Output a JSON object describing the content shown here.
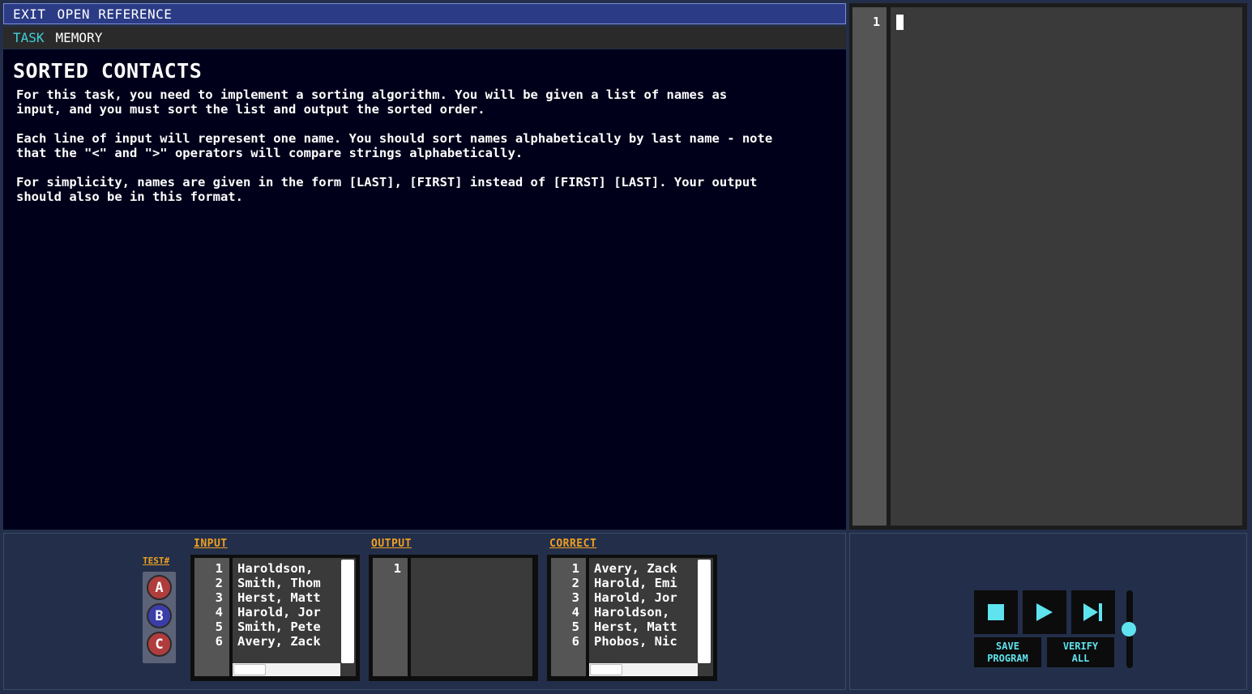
{
  "menu": {
    "exit": "EXIT",
    "open_reference": "OPEN REFERENCE"
  },
  "tabs": [
    {
      "label": "TASK",
      "active": true
    },
    {
      "label": "MEMORY",
      "active": false
    }
  ],
  "task": {
    "title": "SORTED CONTACTS",
    "paragraphs": [
      "For this task, you need to implement a sorting algorithm. You will be given a list of names as\ninput, and you must sort the list and output the sorted order.",
      "Each line of input will represent one name. You should sort names alphabetically by last name - note\nthat the \"<\" and \">\" operators will compare strings alphabetically.",
      "For simplicity, names are given in the form [LAST], [FIRST] instead of [FIRST] [LAST]. Your output\nshould also be in this format."
    ]
  },
  "editor": {
    "line_numbers": [
      "1"
    ]
  },
  "tests": {
    "label": "TEST#",
    "buttons": [
      {
        "label": "A",
        "color": "#b03d3d"
      },
      {
        "label": "B",
        "color": "#3b3ea8",
        "selected": true
      },
      {
        "label": "C",
        "color": "#b03d3d"
      }
    ]
  },
  "io": {
    "input": {
      "label": "INPUT",
      "line_numbers": [
        "1",
        "2",
        "3",
        "4",
        "5",
        "6"
      ],
      "lines": [
        "Haroldson,",
        "Smith, Thom",
        "Herst, Matt",
        "Harold, Jor",
        "Smith, Pete",
        "Avery, Zack"
      ]
    },
    "output": {
      "label": "OUTPUT",
      "line_numbers": [
        "1"
      ],
      "lines": []
    },
    "correct": {
      "label": "CORRECT",
      "line_numbers": [
        "1",
        "2",
        "3",
        "4",
        "5",
        "6"
      ],
      "lines": [
        "Avery, Zack",
        "Harold, Emi",
        "Harold, Jor",
        "Haroldson,",
        "Herst, Matt",
        "Phobos, Nic"
      ]
    }
  },
  "controls": {
    "stop_icon": "stop-icon",
    "run_icon": "play-icon",
    "step_icon": "step-forward-icon",
    "save_label": "SAVE\nPROGRAM",
    "verify_label": "VERIFY\nALL",
    "accent_color": "#5fe3ee"
  }
}
